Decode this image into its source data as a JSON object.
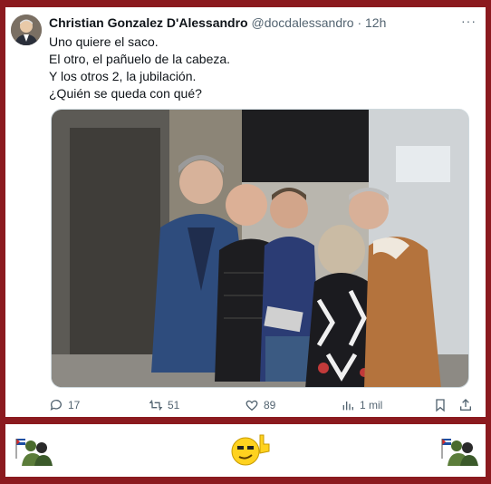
{
  "tweet": {
    "author_name": "Christian Gonzalez D'Alessandro",
    "handle": "@docdalessandro",
    "separator": "·",
    "time": "12h",
    "more": "···",
    "lines": [
      "Uno quiere el saco.",
      "El otro, el pañuelo de la cabeza.",
      "Y los otros 2, la jubilación.",
      "¿Quién se queda con qué?"
    ],
    "replies": "17",
    "reposts": "51",
    "likes": "89",
    "views": "1 mil"
  },
  "icons": {
    "reply": "reply-icon",
    "repost": "repost-icon",
    "like": "heart-icon",
    "views": "views-icon",
    "bookmark": "bookmark-icon",
    "share": "share-icon"
  },
  "colors": {
    "frame": "#8b1a1f",
    "text": "#0f1419",
    "muted": "#536471"
  }
}
